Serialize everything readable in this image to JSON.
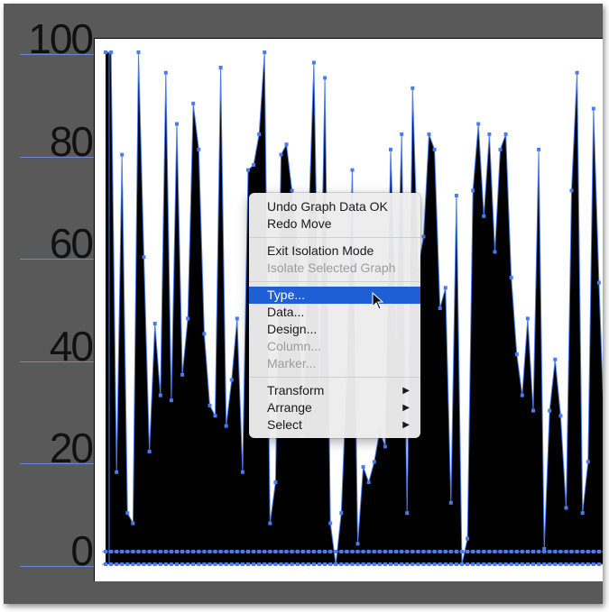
{
  "menu": {
    "groups": [
      [
        {
          "label": "Undo Graph Data OK",
          "enabled": true
        },
        {
          "label": "Redo Move",
          "enabled": true
        }
      ],
      [
        {
          "label": "Exit Isolation Mode",
          "enabled": true
        },
        {
          "label": "Isolate Selected Graph",
          "enabled": false
        }
      ],
      [
        {
          "label": "Type...",
          "enabled": true,
          "selected": true
        },
        {
          "label": "Data...",
          "enabled": true
        },
        {
          "label": "Design...",
          "enabled": true
        },
        {
          "label": "Column...",
          "enabled": false
        },
        {
          "label": "Marker...",
          "enabled": false
        }
      ],
      [
        {
          "label": "Transform",
          "enabled": true,
          "submenu": true
        },
        {
          "label": "Arrange",
          "enabled": true,
          "submenu": true
        },
        {
          "label": "Select",
          "enabled": true,
          "submenu": true
        }
      ]
    ],
    "submenu_glyph": "▶"
  },
  "colors": {
    "selection_blue": "#4a7bef",
    "menu_highlight": "#1f5fd6",
    "fill": "#000000",
    "background": "#595959"
  },
  "chart_data": {
    "type": "area",
    "yticks": [
      "0",
      "20",
      "40",
      "60",
      "80",
      "100"
    ],
    "ylim": [
      0,
      100
    ],
    "values": [
      100,
      100,
      18,
      80,
      10,
      8,
      100,
      60,
      22,
      47,
      33,
      96,
      32,
      86,
      37,
      48,
      90,
      81,
      45,
      31,
      29,
      97,
      27,
      36,
      48,
      18,
      77,
      78,
      84,
      100,
      8,
      16,
      80,
      82,
      73,
      63,
      25,
      65,
      98,
      34,
      95,
      8,
      0,
      10,
      37,
      77,
      4,
      19,
      16,
      20,
      26,
      23,
      81,
      45,
      84,
      10,
      93,
      58,
      64,
      84,
      81,
      50,
      54,
      12,
      72,
      0,
      5,
      73,
      86,
      68,
      84,
      61,
      81,
      84,
      56,
      41,
      33,
      48,
      30,
      81,
      3,
      30,
      40,
      29,
      11,
      73,
      96,
      10,
      20,
      89,
      55,
      25
    ]
  }
}
